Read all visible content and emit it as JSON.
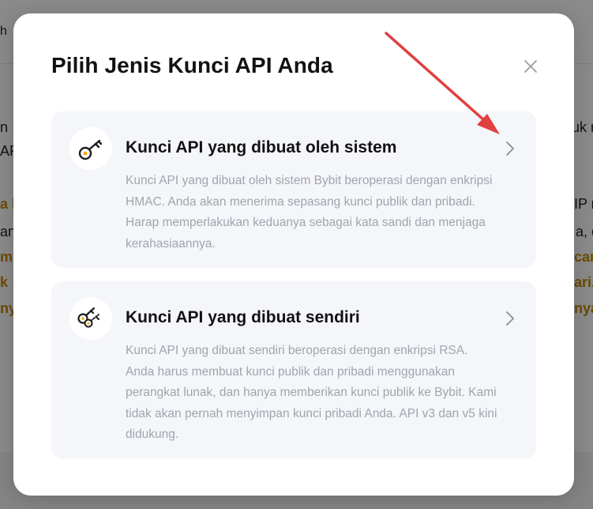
{
  "background": {
    "top_left_fragment": "h",
    "left_fragments": [
      "n",
      "AP"
    ],
    "left_highlight_fragments": [
      "a k",
      "an",
      "m",
      "k",
      "ny"
    ],
    "right_fragments": [
      "uk n",
      "IP n",
      "a, d"
    ],
    "right_highlight_fragments": [
      "car",
      "ari.",
      "nya"
    ]
  },
  "modal": {
    "title": "Pilih Jenis Kunci API Anda",
    "close_icon": "close-icon",
    "cards": [
      {
        "title": "Kunci API yang dibuat oleh sistem",
        "description": "Kunci API yang dibuat oleh sistem Bybit beroperasi dengan enkripsi HMAC. Anda akan menerima sepasang kunci publik dan pribadi. Harap memperlakukan keduanya sebagai kata sandi dan menjaga kerahasiaannya.",
        "icon": "key-icon"
      },
      {
        "title": "Kunci API yang dibuat sendiri",
        "description": "Kunci API yang dibuat sendiri beroperasi dengan enkripsi RSA. Anda harus membuat kunci publik dan pribadi menggunakan perangkat lunak, dan hanya memberikan kunci publik ke Bybit. Kami tidak akan pernah menyimpan kunci pribadi Anda. API v3 dan v5 kini didukung.",
        "icon": "double-key-icon"
      }
    ]
  },
  "colors": {
    "accent": "#f7a600",
    "annotation_arrow": "#e04040",
    "text_primary": "#121214",
    "text_secondary": "#a2a4ad",
    "card_background": "#f5f6fa"
  }
}
